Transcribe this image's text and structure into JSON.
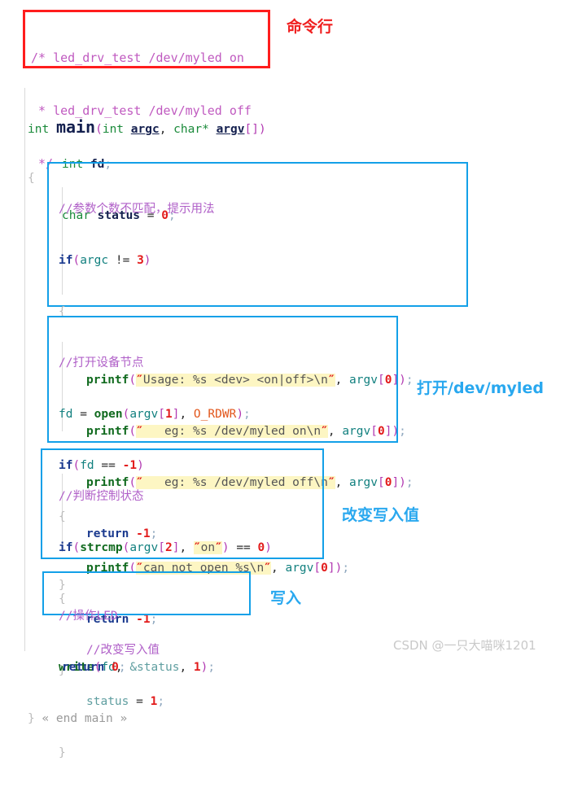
{
  "header_comment_box": {
    "border_color": "#ff1d1d",
    "lines": [
      "/* led_drv_test /dev/myled on",
      " * led_drv_test /dev/myled off",
      " */"
    ]
  },
  "annotations": [
    {
      "name": "command-line",
      "text": "命令行",
      "color": "#f02020"
    },
    {
      "name": "open-dev-myled",
      "text": "打开/dev/myled",
      "color": "#29a8ef"
    },
    {
      "name": "change-write-value",
      "text": "改变写入值",
      "color": "#29a8ef"
    },
    {
      "name": "write",
      "text": "写入",
      "color": "#29a8ef"
    }
  ],
  "signature": {
    "ret": "int",
    "name": "main",
    "open_paren": "(",
    "p1_type": "int",
    "p1_name": "argc",
    "comma": ", ",
    "p2_type": "char*",
    "p2_name": "argv",
    "p2_suffix": "[]",
    "close_paren": ")",
    "open_brace": "{"
  },
  "declarations": [
    {
      "type": "int",
      "name": "fd",
      "init": "",
      "semi": ";"
    },
    {
      "type": "char",
      "name": "status",
      "init": "0",
      "semi": ";"
    }
  ],
  "block_argc_check": {
    "border_color": "#13a0e8",
    "comment": "//参数个数不匹配，提示用法",
    "cond_kw": "if",
    "cond_var": "argc",
    "cond_op": "!=",
    "cond_num": "3",
    "open_brace": "{",
    "close_brace": "}",
    "printfs": [
      {
        "fn": "printf",
        "str": "Usage: %s <dev> <on|off>\\n",
        "arg": "argv",
        "idx": "0"
      },
      {
        "fn": "printf",
        "str": "   eg: %s /dev/myled on\\n",
        "arg": "argv",
        "idx": "0"
      },
      {
        "fn": "printf",
        "str": "   eg: %s /dev/myled off\\n",
        "arg": "argv",
        "idx": "0"
      }
    ],
    "return_kw": "return",
    "return_val": "-1"
  },
  "block_open_device": {
    "border_color": "#13a0e8",
    "comment": "//打开设备节点",
    "assign_lhs": "fd",
    "assign_op": "=",
    "call_fn": "open",
    "call_arg1": "argv",
    "call_idx1": "1",
    "call_arg2": "O_RDWR",
    "cond_kw": "if",
    "cond_var": "fd",
    "cond_op": "==",
    "cond_num": "-1",
    "open_brace": "{",
    "close_brace": "}",
    "printf_fn": "printf",
    "printf_str": "can not open %s\\n",
    "printf_arg": "argv",
    "printf_idx": "0",
    "return_kw": "return",
    "return_val": "-1"
  },
  "block_check_state": {
    "border_color": "#13a0e8",
    "comment": "//判断控制状态",
    "cond_kw": "if",
    "cmp_fn": "strcmp",
    "cmp_arg": "argv",
    "cmp_idx": "2",
    "cmp_str": "on",
    "cmp_op": "==",
    "cmp_num": "0",
    "open_brace": "{",
    "close_brace": "}",
    "inner_comment": "//改变写入值",
    "assign_lhs": "status",
    "assign_op": "=",
    "assign_val": "1"
  },
  "block_write_led": {
    "border_color": "#13a0e8",
    "comment": "//操作LED",
    "fn": "write",
    "arg1": "fd",
    "arg2": "&status",
    "arg3": "1"
  },
  "footer": {
    "return_kw": "return",
    "return_val": "0",
    "close_brace": "}",
    "end_marker": "« end main »"
  },
  "watermark": {
    "text": "CSDN @一只大喵咪1201",
    "color": "#c9c9c9"
  }
}
